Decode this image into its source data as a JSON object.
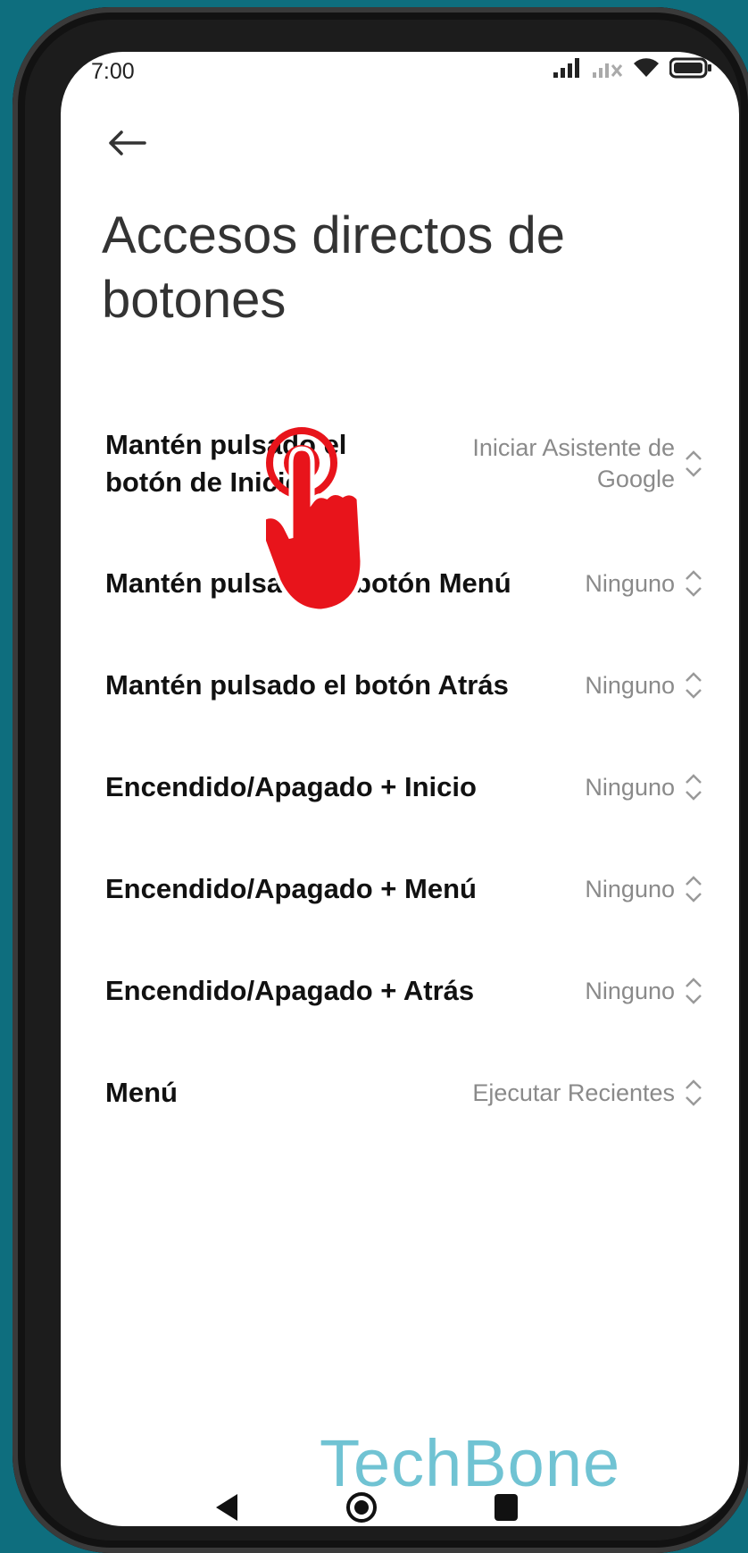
{
  "status_bar": {
    "time": "7:00",
    "icons": [
      "signal-icon",
      "signal-no-sim-icon",
      "wifi-icon",
      "battery-icon"
    ]
  },
  "header": {
    "back_icon": "arrow-left-icon",
    "title": "Accesos directos de botones"
  },
  "settings": [
    {
      "label": "Mantén pulsado el botón de Inicio",
      "value": "Iniciar Asistente de Google"
    },
    {
      "label": "Mantén pulsado el botón Menú",
      "value": "Ninguno"
    },
    {
      "label": "Mantén pulsado el botón Atrás",
      "value": "Ninguno"
    },
    {
      "label": "Encendido/Apagado + Inicio",
      "value": "Ninguno"
    },
    {
      "label": "Encendido/Apagado + Menú",
      "value": "Ninguno"
    },
    {
      "label": "Encendido/Apagado + Atrás",
      "value": "Ninguno"
    },
    {
      "label": "Menú",
      "value": "Ejecutar Recientes"
    }
  ],
  "watermark": "TechBone",
  "colors": {
    "background": "#0e6e7e",
    "accent_tap": "#e8141b",
    "watermark": "#70c3d3"
  }
}
